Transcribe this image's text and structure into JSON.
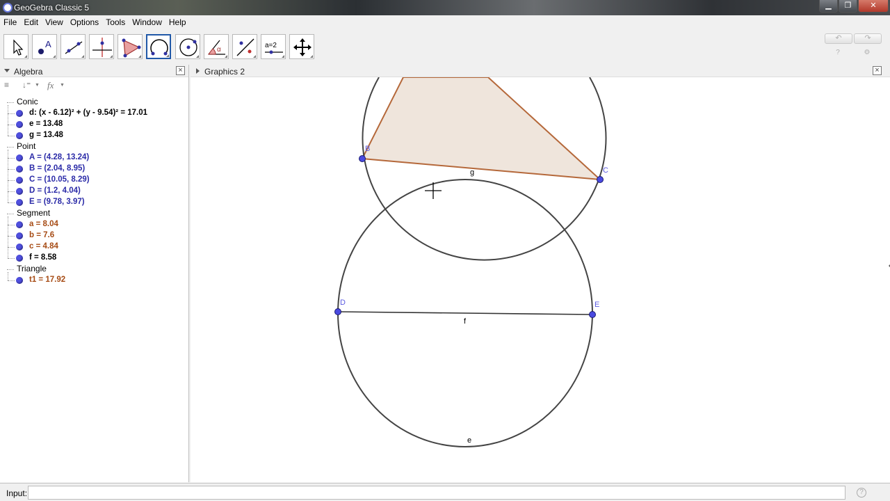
{
  "window": {
    "title": "GeoGebra Classic 5",
    "min": "▁",
    "max": "❐",
    "close": "✕"
  },
  "menu": [
    "File",
    "Edit",
    "View",
    "Options",
    "Tools",
    "Window",
    "Help"
  ],
  "toolbar": {
    "tools": [
      {
        "icon": "move-arrow-icon"
      },
      {
        "icon": "point-icon",
        "letter": "A"
      },
      {
        "icon": "line-icon"
      },
      {
        "icon": "perpendicular-line-icon"
      },
      {
        "icon": "polygon-icon"
      },
      {
        "icon": "circle-arc-icon",
        "selected": true
      },
      {
        "icon": "circle-through-points-icon"
      },
      {
        "icon": "angle-icon",
        "letter": "α"
      },
      {
        "icon": "reflect-icon"
      },
      {
        "icon": "slider-icon",
        "letter": "a=2"
      },
      {
        "icon": "move-graphics-icon"
      }
    ],
    "undo": "↶",
    "redo": "↷",
    "help": "?",
    "settings": "⚙"
  },
  "algebra": {
    "title": "Algebra",
    "close": "×",
    "tool_icons": {
      "sort": "≡",
      "order": "↓⁼",
      "fx": "fx"
    },
    "categories": [
      {
        "name": "Conic",
        "items": [
          {
            "text": "d: (x - 6.12)² + (y - 9.54)² = 17.01",
            "color": "#000000"
          },
          {
            "text": "e = 13.48",
            "color": "#000000"
          },
          {
            "text": "g = 13.48",
            "color": "#000000"
          }
        ]
      },
      {
        "name": "Point",
        "items": [
          {
            "text": "A = (4.28, 13.24)",
            "color": "#2b2ba8"
          },
          {
            "text": "B = (2.04, 8.95)",
            "color": "#2b2ba8"
          },
          {
            "text": "C = (10.05, 8.29)",
            "color": "#2b2ba8"
          },
          {
            "text": "D = (1.2, 4.04)",
            "color": "#2b2ba8"
          },
          {
            "text": "E = (9.78, 3.97)",
            "color": "#2b2ba8"
          }
        ]
      },
      {
        "name": "Segment",
        "items": [
          {
            "text": "a = 8.04",
            "color": "#a64b14"
          },
          {
            "text": "b = 7.6",
            "color": "#a64b14"
          },
          {
            "text": "c = 4.84",
            "color": "#a64b14"
          },
          {
            "text": "f = 8.58",
            "color": "#000000"
          }
        ]
      },
      {
        "name": "Triangle",
        "items": [
          {
            "text": "t1 = 17.92",
            "color": "#a64b14"
          }
        ]
      }
    ]
  },
  "graphics": {
    "title": "Graphics 2",
    "close": "×",
    "labels": {
      "B": "B",
      "C": "C",
      "D": "D",
      "E": "E",
      "g": "g",
      "f": "f",
      "e": "e"
    },
    "colors": {
      "point": "#4a4ae0",
      "polygon_fill": "#efe5dc",
      "polygon_stroke": "#b5683a",
      "conic": "#444444",
      "segment": "#333333",
      "point_label": "#5a5ae0"
    }
  },
  "input": {
    "label": "Input:",
    "value": "",
    "help": "?"
  }
}
